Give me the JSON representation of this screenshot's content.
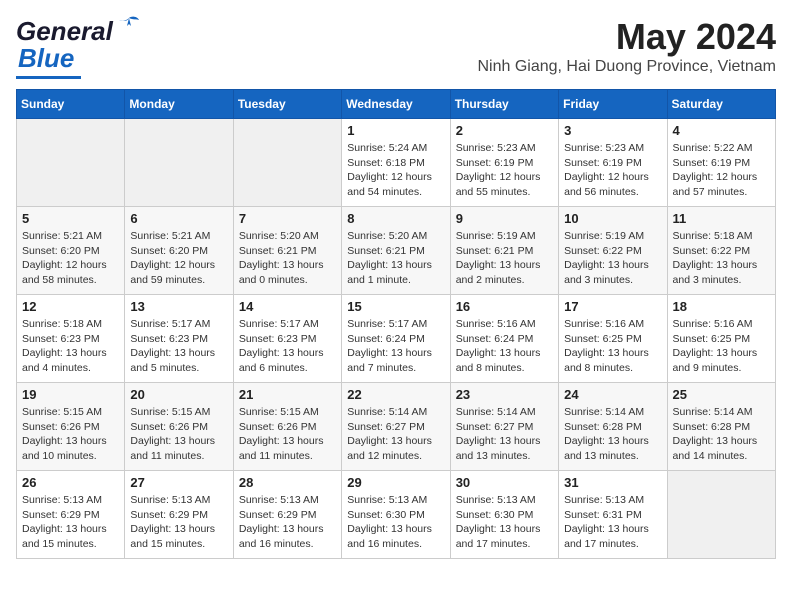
{
  "logo": {
    "line1": "General",
    "line2": "Blue"
  },
  "title": "May 2024",
  "location": "Ninh Giang, Hai Duong Province, Vietnam",
  "days_of_week": [
    "Sunday",
    "Monday",
    "Tuesday",
    "Wednesday",
    "Thursday",
    "Friday",
    "Saturday"
  ],
  "weeks": [
    [
      {
        "day": "",
        "info": ""
      },
      {
        "day": "",
        "info": ""
      },
      {
        "day": "",
        "info": ""
      },
      {
        "day": "1",
        "info": "Sunrise: 5:24 AM\nSunset: 6:18 PM\nDaylight: 12 hours\nand 54 minutes."
      },
      {
        "day": "2",
        "info": "Sunrise: 5:23 AM\nSunset: 6:19 PM\nDaylight: 12 hours\nand 55 minutes."
      },
      {
        "day": "3",
        "info": "Sunrise: 5:23 AM\nSunset: 6:19 PM\nDaylight: 12 hours\nand 56 minutes."
      },
      {
        "day": "4",
        "info": "Sunrise: 5:22 AM\nSunset: 6:19 PM\nDaylight: 12 hours\nand 57 minutes."
      }
    ],
    [
      {
        "day": "5",
        "info": "Sunrise: 5:21 AM\nSunset: 6:20 PM\nDaylight: 12 hours\nand 58 minutes."
      },
      {
        "day": "6",
        "info": "Sunrise: 5:21 AM\nSunset: 6:20 PM\nDaylight: 12 hours\nand 59 minutes."
      },
      {
        "day": "7",
        "info": "Sunrise: 5:20 AM\nSunset: 6:21 PM\nDaylight: 13 hours\nand 0 minutes."
      },
      {
        "day": "8",
        "info": "Sunrise: 5:20 AM\nSunset: 6:21 PM\nDaylight: 13 hours\nand 1 minute."
      },
      {
        "day": "9",
        "info": "Sunrise: 5:19 AM\nSunset: 6:21 PM\nDaylight: 13 hours\nand 2 minutes."
      },
      {
        "day": "10",
        "info": "Sunrise: 5:19 AM\nSunset: 6:22 PM\nDaylight: 13 hours\nand 3 minutes."
      },
      {
        "day": "11",
        "info": "Sunrise: 5:18 AM\nSunset: 6:22 PM\nDaylight: 13 hours\nand 3 minutes."
      }
    ],
    [
      {
        "day": "12",
        "info": "Sunrise: 5:18 AM\nSunset: 6:23 PM\nDaylight: 13 hours\nand 4 minutes."
      },
      {
        "day": "13",
        "info": "Sunrise: 5:17 AM\nSunset: 6:23 PM\nDaylight: 13 hours\nand 5 minutes."
      },
      {
        "day": "14",
        "info": "Sunrise: 5:17 AM\nSunset: 6:23 PM\nDaylight: 13 hours\nand 6 minutes."
      },
      {
        "day": "15",
        "info": "Sunrise: 5:17 AM\nSunset: 6:24 PM\nDaylight: 13 hours\nand 7 minutes."
      },
      {
        "day": "16",
        "info": "Sunrise: 5:16 AM\nSunset: 6:24 PM\nDaylight: 13 hours\nand 8 minutes."
      },
      {
        "day": "17",
        "info": "Sunrise: 5:16 AM\nSunset: 6:25 PM\nDaylight: 13 hours\nand 8 minutes."
      },
      {
        "day": "18",
        "info": "Sunrise: 5:16 AM\nSunset: 6:25 PM\nDaylight: 13 hours\nand 9 minutes."
      }
    ],
    [
      {
        "day": "19",
        "info": "Sunrise: 5:15 AM\nSunset: 6:26 PM\nDaylight: 13 hours\nand 10 minutes."
      },
      {
        "day": "20",
        "info": "Sunrise: 5:15 AM\nSunset: 6:26 PM\nDaylight: 13 hours\nand 11 minutes."
      },
      {
        "day": "21",
        "info": "Sunrise: 5:15 AM\nSunset: 6:26 PM\nDaylight: 13 hours\nand 11 minutes."
      },
      {
        "day": "22",
        "info": "Sunrise: 5:14 AM\nSunset: 6:27 PM\nDaylight: 13 hours\nand 12 minutes."
      },
      {
        "day": "23",
        "info": "Sunrise: 5:14 AM\nSunset: 6:27 PM\nDaylight: 13 hours\nand 13 minutes."
      },
      {
        "day": "24",
        "info": "Sunrise: 5:14 AM\nSunset: 6:28 PM\nDaylight: 13 hours\nand 13 minutes."
      },
      {
        "day": "25",
        "info": "Sunrise: 5:14 AM\nSunset: 6:28 PM\nDaylight: 13 hours\nand 14 minutes."
      }
    ],
    [
      {
        "day": "26",
        "info": "Sunrise: 5:13 AM\nSunset: 6:29 PM\nDaylight: 13 hours\nand 15 minutes."
      },
      {
        "day": "27",
        "info": "Sunrise: 5:13 AM\nSunset: 6:29 PM\nDaylight: 13 hours\nand 15 minutes."
      },
      {
        "day": "28",
        "info": "Sunrise: 5:13 AM\nSunset: 6:29 PM\nDaylight: 13 hours\nand 16 minutes."
      },
      {
        "day": "29",
        "info": "Sunrise: 5:13 AM\nSunset: 6:30 PM\nDaylight: 13 hours\nand 16 minutes."
      },
      {
        "day": "30",
        "info": "Sunrise: 5:13 AM\nSunset: 6:30 PM\nDaylight: 13 hours\nand 17 minutes."
      },
      {
        "day": "31",
        "info": "Sunrise: 5:13 AM\nSunset: 6:31 PM\nDaylight: 13 hours\nand 17 minutes."
      },
      {
        "day": "",
        "info": ""
      }
    ]
  ]
}
